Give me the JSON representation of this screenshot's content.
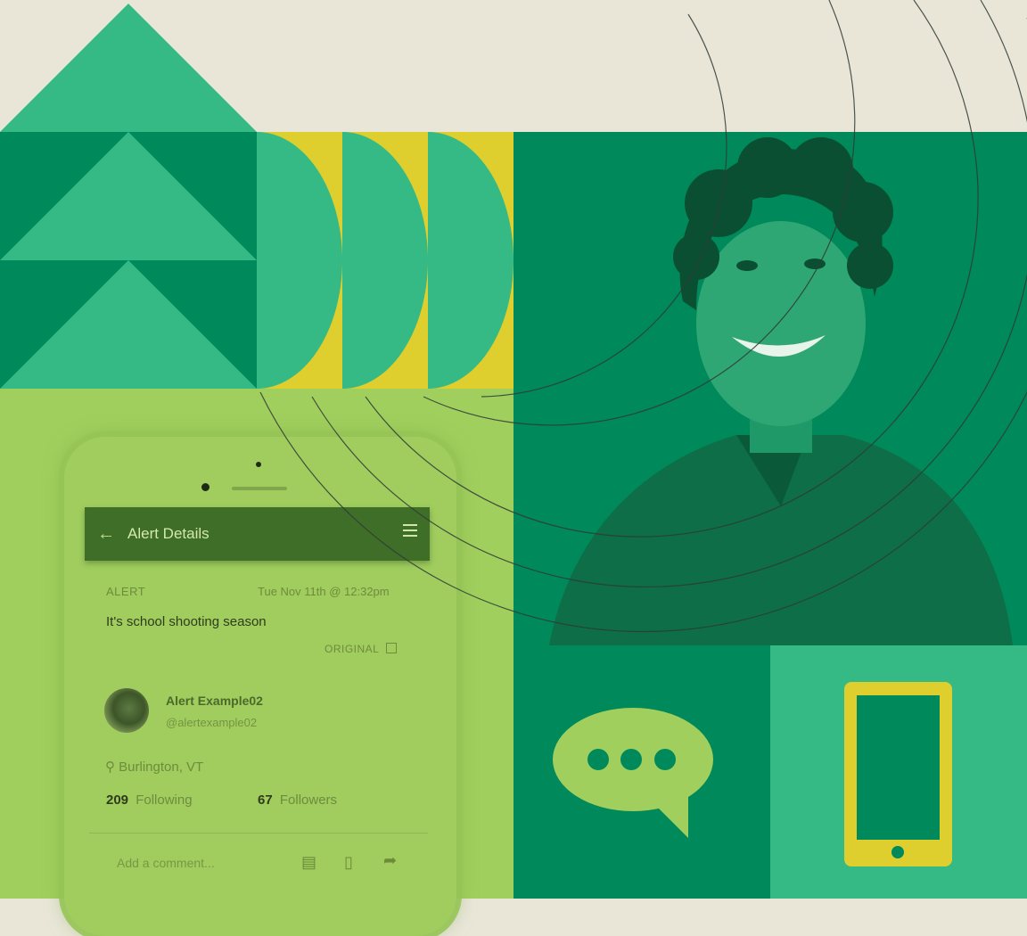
{
  "phone": {
    "header_title": "Alert Details",
    "alert_label": "ALERT",
    "alert_timestamp": "Tue Nov 11th @ 12:32pm",
    "alert_text": "It's school shooting season",
    "original_label": "ORIGINAL",
    "user_name": "Alert Example02",
    "user_handle": "@alertexample02",
    "location": "Burlington, VT",
    "following_count": "209",
    "following_label": "Following",
    "followers_count": "67",
    "followers_label": "Followers",
    "comment_placeholder": "Add a comment..."
  },
  "icons": {
    "chat": "speech-bubble-icon",
    "phone": "smartphone-icon"
  },
  "colors": {
    "dark_green": "#00895a",
    "light_green": "#35b985",
    "yellow": "#dfcf2e",
    "lime": "#a1cf5e",
    "cream": "#e9e6d8"
  }
}
